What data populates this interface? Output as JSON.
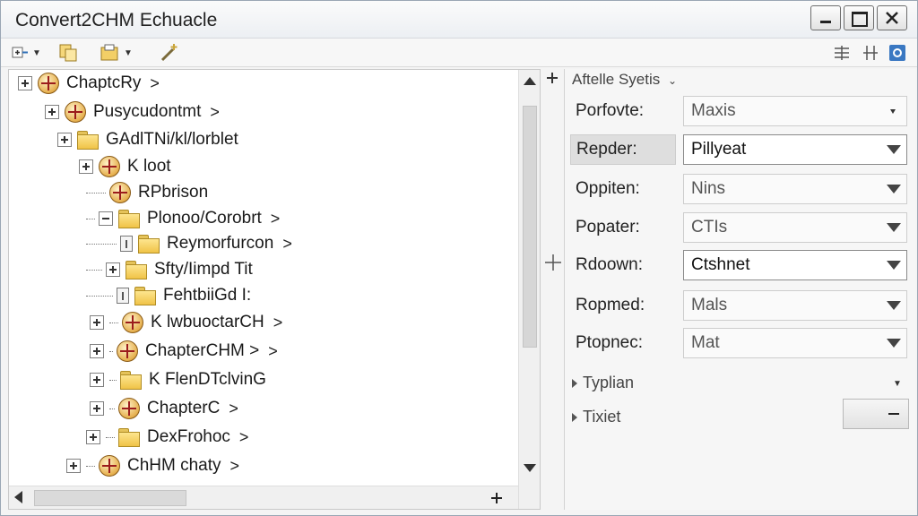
{
  "window": {
    "title": "Convert2CHM Echuacle"
  },
  "tree": {
    "items": [
      {
        "label": "ChaptcRy",
        "icon": "book",
        "chev": ">"
      },
      {
        "label": "Pusycudontmt",
        "icon": "book",
        "chev": ">"
      },
      {
        "label": "GAdlTNi/kl/lorblet",
        "icon": "folder",
        "chev": ""
      },
      {
        "label": "K loot",
        "icon": "book",
        "chev": ""
      },
      {
        "label": "RPbrison",
        "icon": "book",
        "chev": ""
      },
      {
        "label": "Plonoo/Corobrt",
        "icon": "folder",
        "chev": ">"
      },
      {
        "label": "Reymorfurcon",
        "icon": "folder",
        "chev": ">"
      },
      {
        "label": "Sfty/Iimpd Tit",
        "icon": "folder",
        "chev": ""
      },
      {
        "label": "FehtbiiGd I:",
        "icon": "folder",
        "chev": ""
      },
      {
        "label": "K lwbuoctarCH",
        "icon": "book",
        "chev": ">"
      },
      {
        "label": "ChapterCHM >",
        "icon": "book",
        "chev": ">"
      },
      {
        "label": "K FlenDTclvinG",
        "icon": "folder",
        "chev": ""
      },
      {
        "label": "ChapterC",
        "icon": "book",
        "chev": ">"
      },
      {
        "label": "DexFrohoc",
        "icon": "folder",
        "chev": ">"
      },
      {
        "label": "ChHM chaty",
        "icon": "book",
        "chev": ">"
      }
    ]
  },
  "props": {
    "section_title": "Aftelle Syetis",
    "rows": [
      {
        "label": "Porfovte:",
        "value": "Maxis"
      },
      {
        "label": "Repder:",
        "value": "Pillyeat"
      },
      {
        "label": "Oppiten:",
        "value": "Nins"
      },
      {
        "label": "Popater:",
        "value": "CTIs"
      },
      {
        "label": "Rdoown:",
        "value": "Ctshnet"
      },
      {
        "label": "Ropmed:",
        "value": "Mals"
      },
      {
        "label": "Ptopnec:",
        "value": "Mat"
      }
    ],
    "groups": [
      {
        "label": "Typlian"
      },
      {
        "label": "Tixiet"
      }
    ]
  },
  "colors": {
    "accent": "#2f6fb7",
    "book_cross": "#9b1c1c",
    "folder": "#f0c347"
  }
}
